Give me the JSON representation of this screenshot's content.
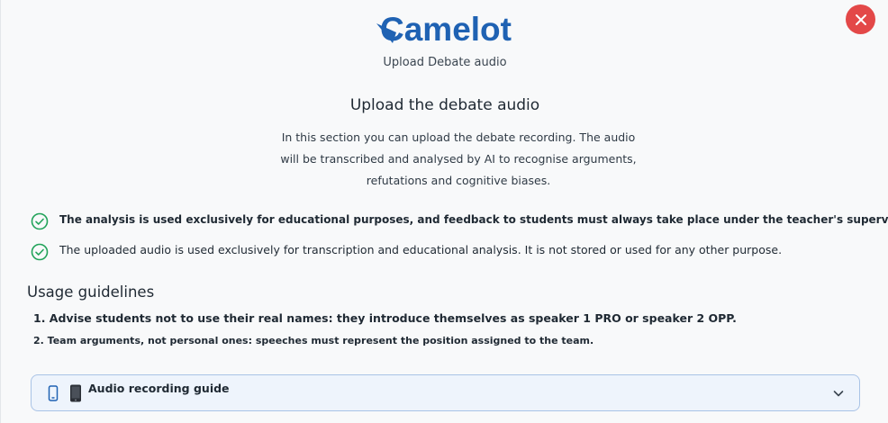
{
  "app": {
    "logo_text": "Camelot",
    "subtitle": "Upload Debate audio"
  },
  "upload": {
    "title": "Upload the debate audio",
    "intro_lines": [
      "In this section you can upload the debate recording. The audio",
      "will be transcribed and analysed by AI to recognise arguments,",
      "refutations and cognitive biases."
    ],
    "notices": [
      "The analysis is used exclusively for educational purposes, and feedback to students must always take place under the teacher's supervision.",
      "The uploaded audio is used exclusively for transcription and educational analysis. It is not stored or used for any other purpose."
    ]
  },
  "guidelines": {
    "title": "Usage guidelines",
    "items": [
      "1. Advise students not to use their real names: they introduce themselves as speaker 1 PRO or speaker 2 OPP.",
      "2. Team arguments, not personal ones: speeches must represent the position assigned to the team."
    ]
  },
  "accordion": {
    "label": "Audio recording guide"
  },
  "icons": {
    "close": "close-icon",
    "check": "check-circle-icon",
    "phone": "smartphone-icon",
    "chevron": "chevron-down-icon"
  },
  "colors": {
    "brand": "#1f62b3",
    "close": "#e34848",
    "check": "#22a35a",
    "accordion_border": "#a9c3e6",
    "accordion_bg": "#eef4fc"
  }
}
